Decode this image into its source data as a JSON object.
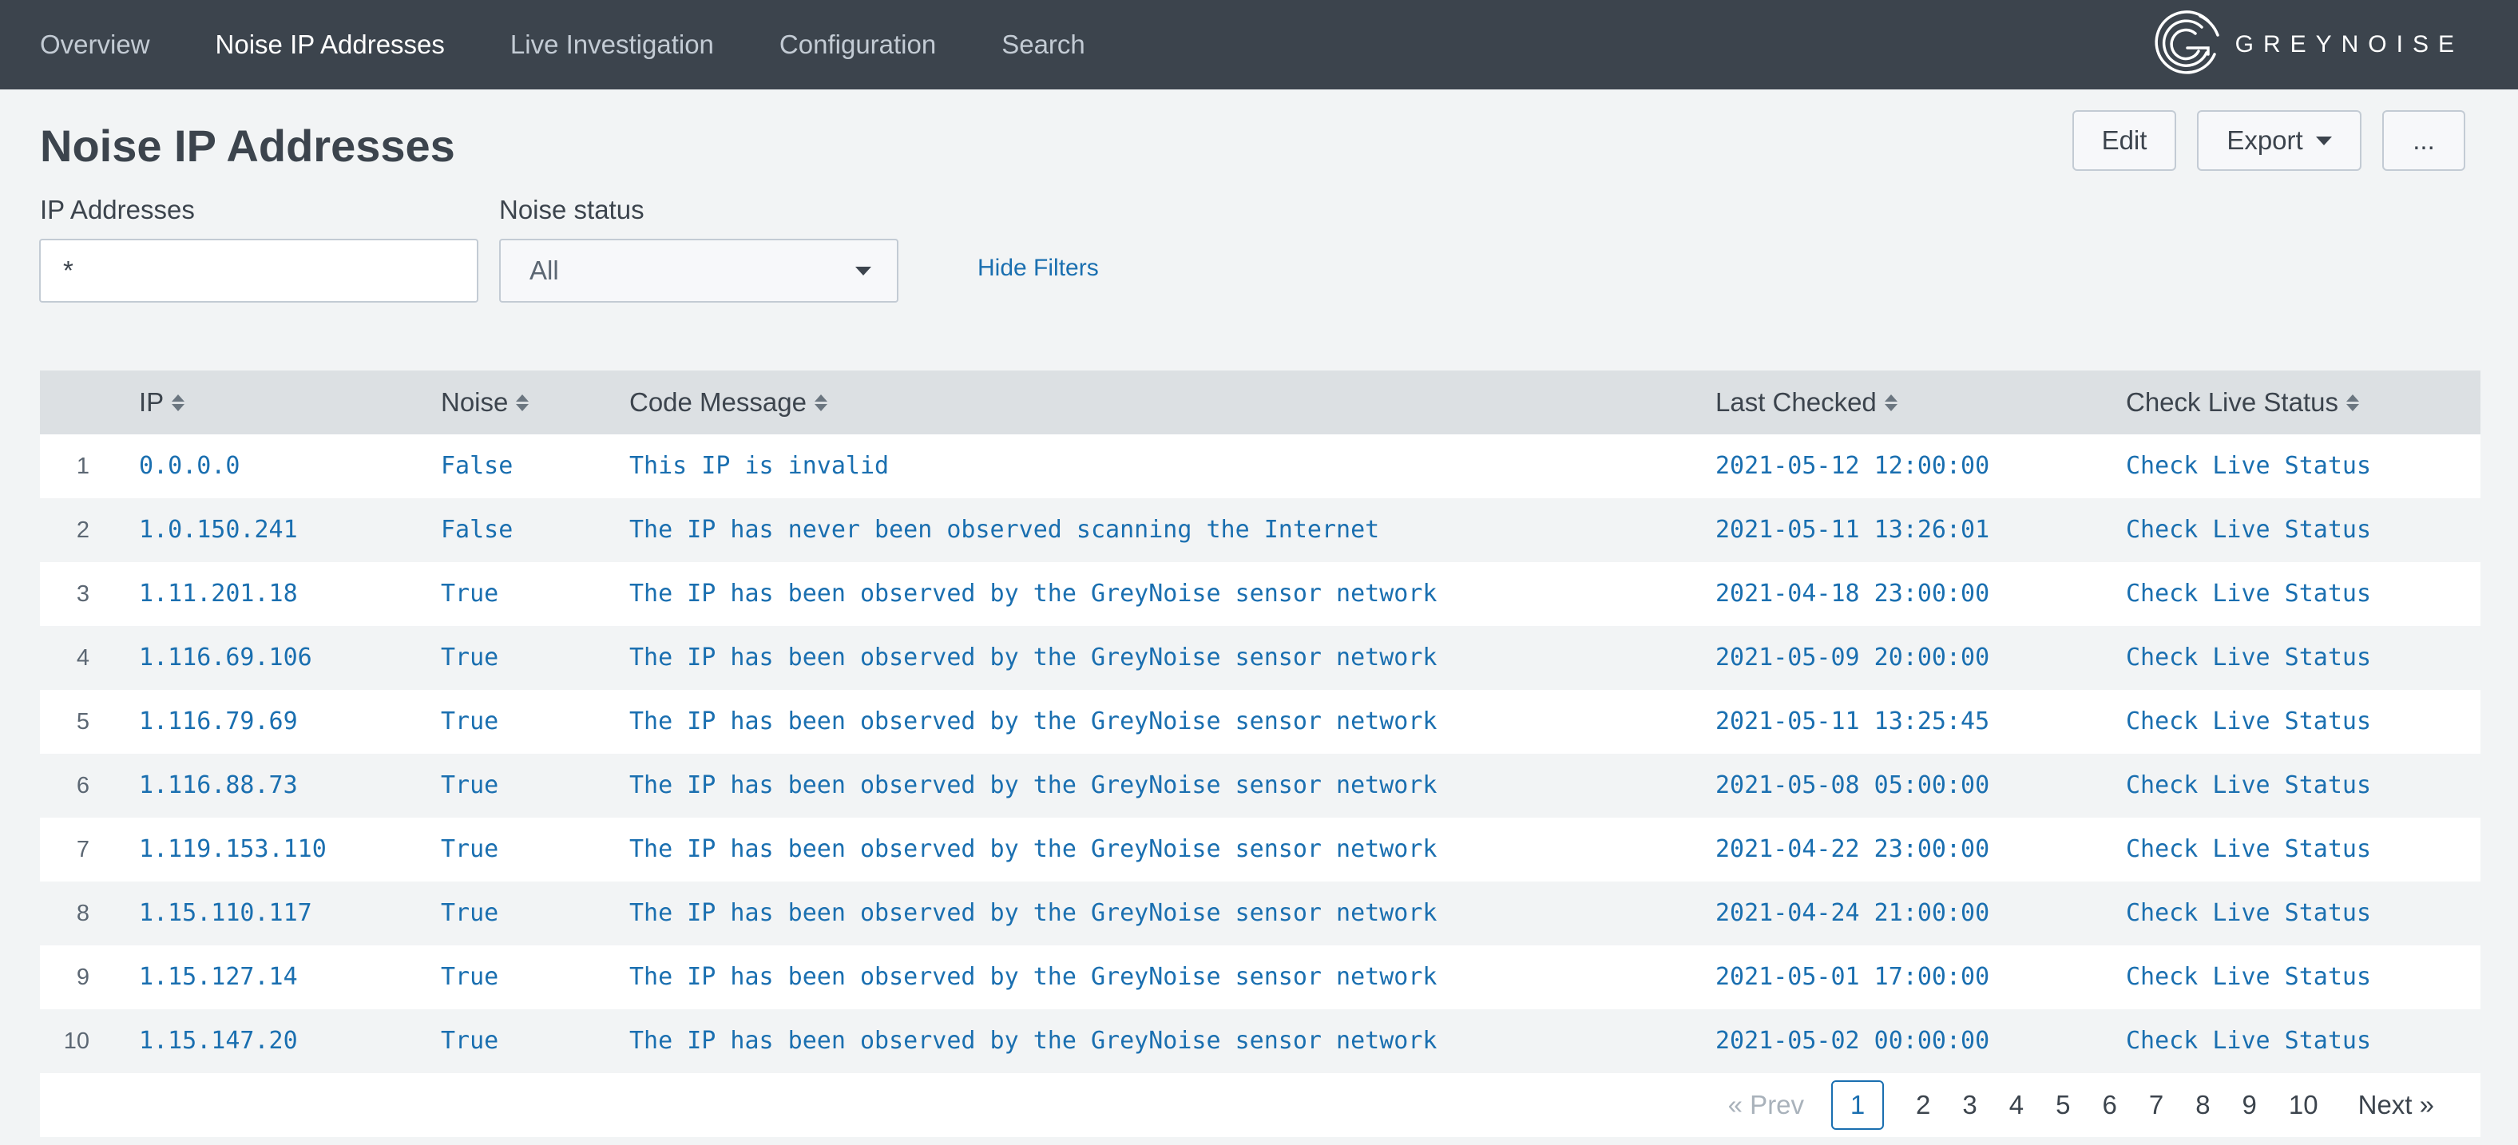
{
  "nav": {
    "items": [
      {
        "label": "Overview",
        "active": false
      },
      {
        "label": "Noise IP Addresses",
        "active": true
      },
      {
        "label": "Live Investigation",
        "active": false
      },
      {
        "label": "Configuration",
        "active": false
      },
      {
        "label": "Search",
        "active": false
      }
    ],
    "brand": "GREYNOISE"
  },
  "page": {
    "title": "Noise IP Addresses",
    "actions": {
      "edit": "Edit",
      "export": "Export",
      "more": "..."
    }
  },
  "filters": {
    "ip_label": "IP Addresses",
    "ip_value": "*",
    "noise_label": "Noise status",
    "noise_value": "All",
    "hide": "Hide Filters"
  },
  "table": {
    "columns": [
      "IP",
      "Noise",
      "Code Message",
      "Last Checked",
      "Check Live Status"
    ],
    "rows": [
      {
        "n": "1",
        "ip": "0.0.0.0",
        "noise": "False",
        "msg": "This IP is invalid",
        "checked": "2021-05-12 12:00:00",
        "live": "Check Live Status"
      },
      {
        "n": "2",
        "ip": "1.0.150.241",
        "noise": "False",
        "msg": "The IP has never been observed scanning the Internet",
        "checked": "2021-05-11 13:26:01",
        "live": "Check Live Status"
      },
      {
        "n": "3",
        "ip": "1.11.201.18",
        "noise": "True",
        "msg": "The IP has been observed by the GreyNoise sensor network",
        "checked": "2021-04-18 23:00:00",
        "live": "Check Live Status"
      },
      {
        "n": "4",
        "ip": "1.116.69.106",
        "noise": "True",
        "msg": "The IP has been observed by the GreyNoise sensor network",
        "checked": "2021-05-09 20:00:00",
        "live": "Check Live Status"
      },
      {
        "n": "5",
        "ip": "1.116.79.69",
        "noise": "True",
        "msg": "The IP has been observed by the GreyNoise sensor network",
        "checked": "2021-05-11 13:25:45",
        "live": "Check Live Status"
      },
      {
        "n": "6",
        "ip": "1.116.88.73",
        "noise": "True",
        "msg": "The IP has been observed by the GreyNoise sensor network",
        "checked": "2021-05-08 05:00:00",
        "live": "Check Live Status"
      },
      {
        "n": "7",
        "ip": "1.119.153.110",
        "noise": "True",
        "msg": "The IP has been observed by the GreyNoise sensor network",
        "checked": "2021-04-22 23:00:00",
        "live": "Check Live Status"
      },
      {
        "n": "8",
        "ip": "1.15.110.117",
        "noise": "True",
        "msg": "The IP has been observed by the GreyNoise sensor network",
        "checked": "2021-04-24 21:00:00",
        "live": "Check Live Status"
      },
      {
        "n": "9",
        "ip": "1.15.127.14",
        "noise": "True",
        "msg": "The IP has been observed by the GreyNoise sensor network",
        "checked": "2021-05-01 17:00:00",
        "live": "Check Live Status"
      },
      {
        "n": "10",
        "ip": "1.15.147.20",
        "noise": "True",
        "msg": "The IP has been observed by the GreyNoise sensor network",
        "checked": "2021-05-02 00:00:00",
        "live": "Check Live Status"
      }
    ]
  },
  "pagination": {
    "prev": "« Prev",
    "pages": [
      "1",
      "2",
      "3",
      "4",
      "5",
      "6",
      "7",
      "8",
      "9",
      "10"
    ],
    "current": "1",
    "next": "Next »"
  },
  "colors": {
    "topbar": "#3c444d",
    "link": "#1a6fb0",
    "header_row": "#dce0e3",
    "background": "#f2f4f5"
  },
  "icons": {
    "brand_logo": "greynoise-logo-icon",
    "sort": "sort-icon",
    "dropdown": "caret-down-icon"
  }
}
